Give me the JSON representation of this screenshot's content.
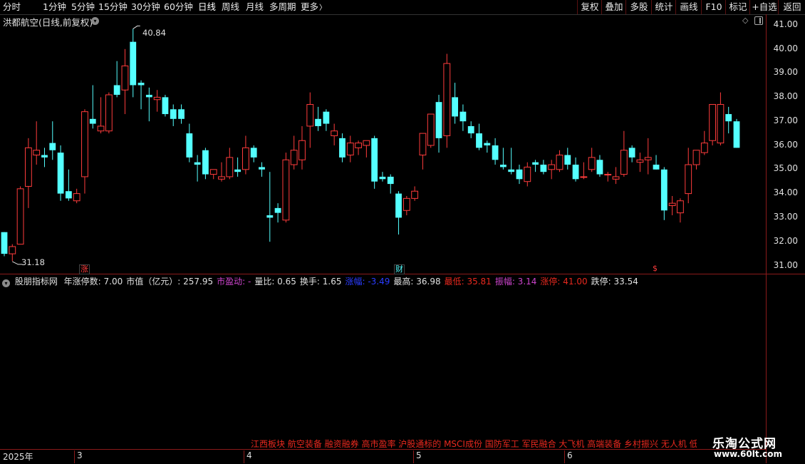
{
  "toolbar": {
    "periods": [
      "分时",
      "1分钟",
      "5分钟",
      "15分钟",
      "30分钟",
      "60分钟",
      "日线",
      "周线",
      "月线",
      "多周期",
      "更多"
    ],
    "more_arrow": "〉",
    "right_buttons": [
      "复权",
      "叠加",
      "多股",
      "统计",
      "画线",
      "F10",
      "标记",
      "+自选",
      "返回"
    ]
  },
  "stock": {
    "title": "洪都航空(日线,前复权)"
  },
  "price_axis": {
    "ticks": [
      "41.00",
      "40.00",
      "39.00",
      "38.00",
      "37.00",
      "36.00",
      "35.00",
      "34.00",
      "33.00",
      "32.00",
      "31.00"
    ]
  },
  "annotations": {
    "high": "40.84",
    "low": "31.18",
    "markers": [
      "涨",
      "财",
      "$"
    ]
  },
  "indicator": {
    "name": "股朋指标网",
    "fields": [
      {
        "label": "年涨停数: 7.00",
        "color": "#e0e0e0"
      },
      {
        "label": "市值（亿元）: 257.95",
        "color": "#e0e0e0"
      },
      {
        "label": "市盈动: -",
        "color": "#cc44cc"
      },
      {
        "label": "量比: 0.65",
        "color": "#e0e0e0"
      },
      {
        "label": "换手: 1.65",
        "color": "#e0e0e0"
      },
      {
        "label": "涨幅: -3.49",
        "color": "#2a3cff"
      },
      {
        "label": "最高: 36.98",
        "color": "#e0e0e0"
      },
      {
        "label": "最低: 35.81",
        "color": "#e8281e"
      },
      {
        "label": "振幅: 3.14",
        "color": "#cc44cc"
      },
      {
        "label": "涨停: 41.00",
        "color": "#e8281e"
      },
      {
        "label": "跌停: 33.54",
        "color": "#e0e0e0"
      }
    ]
  },
  "concepts": "江西板块 航空装备 融资融券 高市盈率 沪股通标的 MSCI成份 国防军工 军民融合 大飞机 高端装备 乡村振兴 无人机 低空",
  "dates": [
    "2025年",
    "3",
    "4",
    "5",
    "6"
  ],
  "logo": {
    "name": "乐淘公式网",
    "url": "www.60lt.com"
  },
  "colors": {
    "up": "#ff3c3c",
    "down": "#54ffff",
    "border": "#8b1a1a"
  },
  "chart_data": {
    "type": "candlestick",
    "ylim": [
      31.0,
      41.0
    ],
    "candles": [
      {
        "o": 32.4,
        "h": 32.4,
        "l": 31.4,
        "c": 31.5
      },
      {
        "o": 31.5,
        "h": 31.9,
        "l": 31.2,
        "c": 31.8
      },
      {
        "o": 31.9,
        "h": 34.3,
        "l": 31.9,
        "c": 34.2
      },
      {
        "o": 34.3,
        "h": 36.3,
        "l": 33.4,
        "c": 35.9
      },
      {
        "o": 35.6,
        "h": 37.0,
        "l": 35.2,
        "c": 35.8
      },
      {
        "o": 35.6,
        "h": 35.9,
        "l": 35.1,
        "c": 35.5
      },
      {
        "o": 36.1,
        "h": 37.0,
        "l": 35.4,
        "c": 35.8
      },
      {
        "o": 35.7,
        "h": 36.0,
        "l": 33.7,
        "c": 34.0
      },
      {
        "o": 34.1,
        "h": 35.0,
        "l": 33.7,
        "c": 33.8
      },
      {
        "o": 33.7,
        "h": 34.2,
        "l": 33.6,
        "c": 34.0
      },
      {
        "o": 34.7,
        "h": 37.5,
        "l": 34.0,
        "c": 37.4
      },
      {
        "o": 37.1,
        "h": 38.5,
        "l": 36.7,
        "c": 36.9
      },
      {
        "o": 36.6,
        "h": 38.0,
        "l": 36.5,
        "c": 36.8
      },
      {
        "o": 36.6,
        "h": 38.2,
        "l": 36.5,
        "c": 38.1
      },
      {
        "o": 38.5,
        "h": 39.5,
        "l": 38.0,
        "c": 38.1
      },
      {
        "o": 38.3,
        "h": 40.0,
        "l": 37.3,
        "c": 39.3
      },
      {
        "o": 40.3,
        "h": 40.84,
        "l": 38.0,
        "c": 38.5
      },
      {
        "o": 38.6,
        "h": 38.7,
        "l": 37.5,
        "c": 38.5
      },
      {
        "o": 38.1,
        "h": 38.4,
        "l": 37.0,
        "c": 38.0
      },
      {
        "o": 37.9,
        "h": 38.3,
        "l": 37.4,
        "c": 38.0
      },
      {
        "o": 38.0,
        "h": 38.1,
        "l": 37.2,
        "c": 37.3
      },
      {
        "o": 37.5,
        "h": 37.7,
        "l": 36.8,
        "c": 37.1
      },
      {
        "o": 37.5,
        "h": 37.7,
        "l": 36.9,
        "c": 37.1
      },
      {
        "o": 36.5,
        "h": 36.9,
        "l": 35.3,
        "c": 35.5
      },
      {
        "o": 35.3,
        "h": 35.6,
        "l": 34.5,
        "c": 35.2
      },
      {
        "o": 35.8,
        "h": 35.9,
        "l": 34.6,
        "c": 34.8
      },
      {
        "o": 34.8,
        "h": 35.0,
        "l": 34.6,
        "c": 35.0
      },
      {
        "o": 34.6,
        "h": 35.3,
        "l": 34.5,
        "c": 34.7
      },
      {
        "o": 34.7,
        "h": 35.9,
        "l": 34.6,
        "c": 35.5
      },
      {
        "o": 35.0,
        "h": 35.5,
        "l": 34.7,
        "c": 34.9
      },
      {
        "o": 35.0,
        "h": 36.4,
        "l": 34.8,
        "c": 35.9
      },
      {
        "o": 35.9,
        "h": 36.0,
        "l": 35.3,
        "c": 35.5
      },
      {
        "o": 35.1,
        "h": 35.3,
        "l": 34.7,
        "c": 35.0
      },
      {
        "o": 33.1,
        "h": 34.9,
        "l": 32.0,
        "c": 33.0
      },
      {
        "o": 33.4,
        "h": 33.6,
        "l": 32.8,
        "c": 33.2
      },
      {
        "o": 32.9,
        "h": 35.7,
        "l": 32.8,
        "c": 35.4
      },
      {
        "o": 35.2,
        "h": 36.4,
        "l": 35.0,
        "c": 35.8
      },
      {
        "o": 35.4,
        "h": 36.8,
        "l": 35.0,
        "c": 36.2
      },
      {
        "o": 36.8,
        "h": 38.2,
        "l": 35.9,
        "c": 37.7
      },
      {
        "o": 37.1,
        "h": 37.6,
        "l": 36.6,
        "c": 36.8
      },
      {
        "o": 37.4,
        "h": 37.5,
        "l": 36.6,
        "c": 36.9
      },
      {
        "o": 36.4,
        "h": 36.9,
        "l": 36.0,
        "c": 36.6
      },
      {
        "o": 36.3,
        "h": 36.5,
        "l": 35.3,
        "c": 35.5
      },
      {
        "o": 35.6,
        "h": 36.4,
        "l": 35.3,
        "c": 36.1
      },
      {
        "o": 35.9,
        "h": 36.2,
        "l": 35.6,
        "c": 36.1
      },
      {
        "o": 36.0,
        "h": 36.2,
        "l": 35.5,
        "c": 36.2
      },
      {
        "o": 36.3,
        "h": 36.4,
        "l": 34.2,
        "c": 34.5
      },
      {
        "o": 34.7,
        "h": 34.9,
        "l": 34.5,
        "c": 34.6
      },
      {
        "o": 34.7,
        "h": 34.8,
        "l": 34.0,
        "c": 34.4
      },
      {
        "o": 34.0,
        "h": 34.1,
        "l": 32.3,
        "c": 33.0
      },
      {
        "o": 33.3,
        "h": 33.9,
        "l": 33.1,
        "c": 33.8
      },
      {
        "o": 33.8,
        "h": 34.3,
        "l": 33.7,
        "c": 34.1
      },
      {
        "o": 35.6,
        "h": 36.3,
        "l": 35.0,
        "c": 36.5
      },
      {
        "o": 36.0,
        "h": 37.3,
        "l": 35.9,
        "c": 37.3
      },
      {
        "o": 37.8,
        "h": 38.1,
        "l": 35.7,
        "c": 36.3
      },
      {
        "o": 36.4,
        "h": 39.8,
        "l": 35.9,
        "c": 39.4
      },
      {
        "o": 38.0,
        "h": 38.6,
        "l": 36.9,
        "c": 37.2
      },
      {
        "o": 37.4,
        "h": 37.7,
        "l": 36.6,
        "c": 37.0
      },
      {
        "o": 36.8,
        "h": 37.0,
        "l": 36.3,
        "c": 36.5
      },
      {
        "o": 36.5,
        "h": 36.9,
        "l": 35.8,
        "c": 35.9
      },
      {
        "o": 36.1,
        "h": 36.2,
        "l": 35.7,
        "c": 36.0
      },
      {
        "o": 36.0,
        "h": 36.3,
        "l": 35.2,
        "c": 35.4
      },
      {
        "o": 35.2,
        "h": 35.9,
        "l": 35.0,
        "c": 35.1
      },
      {
        "o": 35.0,
        "h": 35.9,
        "l": 34.8,
        "c": 34.9
      },
      {
        "o": 35.0,
        "h": 35.2,
        "l": 34.4,
        "c": 34.6
      },
      {
        "o": 34.5,
        "h": 35.3,
        "l": 34.3,
        "c": 35.1
      },
      {
        "o": 35.3,
        "h": 35.4,
        "l": 34.9,
        "c": 35.2
      },
      {
        "o": 35.2,
        "h": 35.4,
        "l": 34.8,
        "c": 34.9
      },
      {
        "o": 35.0,
        "h": 35.4,
        "l": 34.6,
        "c": 35.2
      },
      {
        "o": 35.0,
        "h": 35.8,
        "l": 34.9,
        "c": 35.6
      },
      {
        "o": 35.6,
        "h": 35.9,
        "l": 35.0,
        "c": 35.2
      },
      {
        "o": 35.2,
        "h": 35.5,
        "l": 34.5,
        "c": 34.6
      },
      {
        "o": 34.7,
        "h": 35.3,
        "l": 34.6,
        "c": 34.7
      },
      {
        "o": 35.0,
        "h": 35.9,
        "l": 34.9,
        "c": 35.5
      },
      {
        "o": 35.4,
        "h": 35.6,
        "l": 34.7,
        "c": 34.8
      },
      {
        "o": 34.8,
        "h": 34.9,
        "l": 34.5,
        "c": 34.8
      },
      {
        "o": 34.6,
        "h": 35.1,
        "l": 34.4,
        "c": 34.7
      },
      {
        "o": 34.8,
        "h": 36.6,
        "l": 34.7,
        "c": 35.8
      },
      {
        "o": 35.9,
        "h": 36.0,
        "l": 35.3,
        "c": 35.5
      },
      {
        "o": 35.3,
        "h": 35.7,
        "l": 34.9,
        "c": 35.4
      },
      {
        "o": 35.4,
        "h": 36.3,
        "l": 34.8,
        "c": 35.5
      },
      {
        "o": 35.2,
        "h": 35.6,
        "l": 35.0,
        "c": 35.0
      },
      {
        "o": 35.0,
        "h": 35.1,
        "l": 32.9,
        "c": 33.3
      },
      {
        "o": 33.5,
        "h": 33.9,
        "l": 33.1,
        "c": 33.6
      },
      {
        "o": 33.2,
        "h": 33.8,
        "l": 32.8,
        "c": 33.7
      },
      {
        "o": 34.0,
        "h": 35.9,
        "l": 33.6,
        "c": 35.2
      },
      {
        "o": 35.2,
        "h": 35.8,
        "l": 35.0,
        "c": 35.8
      },
      {
        "o": 35.7,
        "h": 36.6,
        "l": 35.6,
        "c": 36.1
      },
      {
        "o": 36.2,
        "h": 37.2,
        "l": 36.0,
        "c": 37.7
      },
      {
        "o": 36.1,
        "h": 38.2,
        "l": 36.0,
        "c": 37.7
      },
      {
        "o": 37.3,
        "h": 37.6,
        "l": 36.5,
        "c": 37.0
      },
      {
        "o": 37.0,
        "h": 37.1,
        "l": 35.9,
        "c": 35.9
      }
    ]
  }
}
